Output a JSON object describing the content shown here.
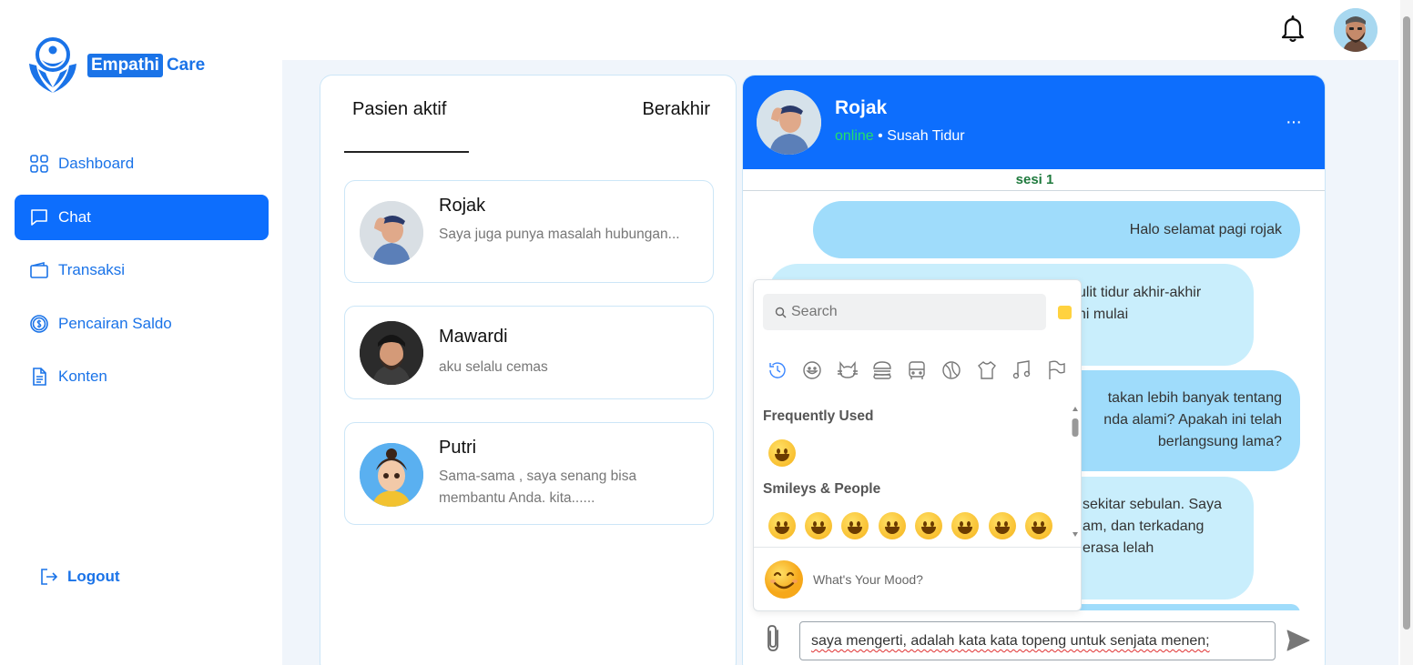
{
  "app": {
    "logo_part1": "Empathi",
    "logo_part2": "Care"
  },
  "sidebar": {
    "items": [
      {
        "label": "Dashboard",
        "icon": "grid-icon"
      },
      {
        "label": "Chat",
        "icon": "chat-icon",
        "active": true
      },
      {
        "label": "Transaksi",
        "icon": "wallet-icon"
      },
      {
        "label": "Pencairan Saldo",
        "icon": "dollar-coin-icon"
      },
      {
        "label": "Konten",
        "icon": "document-icon"
      }
    ],
    "logout_label": "Logout"
  },
  "patients": {
    "tab_active": "Pasien aktif",
    "tab_ended": "Berakhir",
    "list": [
      {
        "name": "Rojak",
        "message": "Saya juga punya masalah hubungan..."
      },
      {
        "name": "Mawardi",
        "message": "aku selalu cemas"
      },
      {
        "name": "Putri",
        "message": "Sama-sama , saya senang bisa membantu Anda. kita......"
      }
    ]
  },
  "chat": {
    "name": "Rojak",
    "status": "online",
    "separator": "•",
    "topic": "Susah Tidur",
    "more": "···",
    "session": "sesi 1",
    "messages": [
      {
        "dir": "out",
        "text": "Halo selamat pagi rojak"
      },
      {
        "dir": "in",
        "line1": "ulit tidur akhir-akhir",
        "line2": "ni mulai"
      },
      {
        "dir": "out",
        "line1": "takan lebih banyak tentang",
        "line2": "nda alami? Apakah ini telah",
        "line3": "berlangsung lama?"
      },
      {
        "dir": "in",
        "line1": "sekitar sebulan. Saya",
        "line2": "am, dan terkadang",
        "line3": "erasa lelah"
      }
    ],
    "input_value": "saya mengerti, adalah kata kata topeng untuk senjata menen;"
  },
  "emoji_picker": {
    "search_placeholder": "Search",
    "categories": [
      "recent-icon",
      "smiley-icon",
      "cat-icon",
      "burger-icon",
      "bus-icon",
      "ball-icon",
      "shirt-icon",
      "music-icon",
      "flag-icon"
    ],
    "frequently_used_title": "Frequently Used",
    "frequently_used": [
      "😀"
    ],
    "smileys_title": "Smileys & People",
    "smileys": [
      "😀",
      "😃",
      "😄",
      "😁",
      "😆",
      "😅",
      "🤣",
      "😂"
    ],
    "mood_label": "What's Your Mood?",
    "skin_tone_color": "#ffd23f"
  },
  "colors": {
    "primary": "#0d6efd",
    "accent": "#1a73e8",
    "online": "#22e06b",
    "bubble_out": "#9fdcfb",
    "bubble_in": "#c9eefc"
  }
}
